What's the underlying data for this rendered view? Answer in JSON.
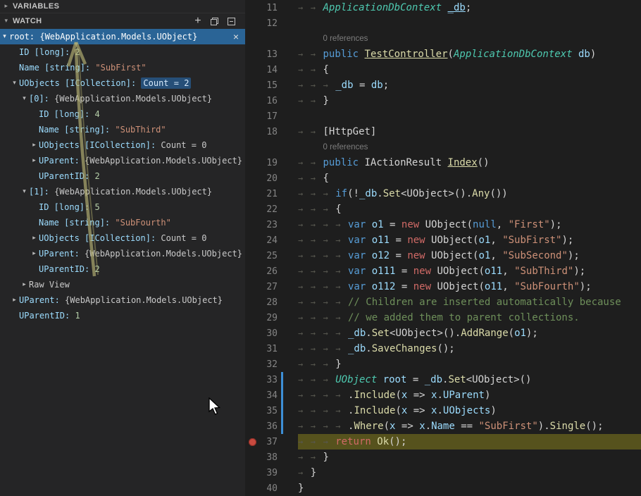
{
  "colors": {
    "selection_blue": "#2a6496",
    "current_line_highlight": "#56521d",
    "breakpoint_red": "#c84a3f",
    "modified_gutter_blue": "#3d8fd6",
    "sidebar_bg": "#252526",
    "editor_bg": "#1e1e1e"
  },
  "icons": {
    "add": "+",
    "close": "×",
    "twisty_down": "▾",
    "twisty_right": "▸",
    "variables_chevron": "▸",
    "watch_chevron": "▾",
    "tab": "→"
  },
  "sidebar": {
    "variables_header": "VARIABLES",
    "watch_header": "WATCH",
    "rows": [
      {
        "indent": 0,
        "twisty": "down",
        "selected": true,
        "close": true,
        "parts": [
          [
            "sel",
            "root: {WebApplication.Models.UObject}"
          ]
        ]
      },
      {
        "indent": 1,
        "parts": [
          [
            "name",
            "ID [long]: "
          ],
          [
            "num",
            "2"
          ]
        ]
      },
      {
        "indent": 1,
        "parts": [
          [
            "name",
            "Name [string]: "
          ],
          [
            "str",
            "\"SubFirst\""
          ]
        ]
      },
      {
        "indent": 1,
        "twisty": "down",
        "parts": [
          [
            "name",
            "UObjects [ICollection]: "
          ],
          [
            "chip",
            "Count = 2"
          ]
        ]
      },
      {
        "indent": 2,
        "twisty": "down",
        "parts": [
          [
            "name",
            "[0]: "
          ],
          [
            "obj",
            "{WebApplication.Models.UObject}"
          ]
        ]
      },
      {
        "indent": 3,
        "parts": [
          [
            "name",
            "ID [long]: "
          ],
          [
            "num",
            "4"
          ]
        ]
      },
      {
        "indent": 3,
        "parts": [
          [
            "name",
            "Name [string]: "
          ],
          [
            "str",
            "\"SubThird\""
          ]
        ]
      },
      {
        "indent": 3,
        "twisty": "right",
        "parts": [
          [
            "name",
            "UObjects [ICollection]: "
          ],
          [
            "obj",
            "Count = 0"
          ]
        ]
      },
      {
        "indent": 3,
        "twisty": "right",
        "parts": [
          [
            "name",
            "UParent: "
          ],
          [
            "obj",
            "{WebApplication.Models.UObject}"
          ]
        ]
      },
      {
        "indent": 3,
        "parts": [
          [
            "name",
            "UParentID: "
          ],
          [
            "num",
            "2"
          ]
        ]
      },
      {
        "indent": 2,
        "twisty": "down",
        "parts": [
          [
            "name",
            "[1]: "
          ],
          [
            "obj",
            "{WebApplication.Models.UObject}"
          ]
        ]
      },
      {
        "indent": 3,
        "parts": [
          [
            "name",
            "ID [long]: "
          ],
          [
            "num",
            "5"
          ]
        ]
      },
      {
        "indent": 3,
        "parts": [
          [
            "name",
            "Name [string]: "
          ],
          [
            "str",
            "\"SubFourth\""
          ]
        ]
      },
      {
        "indent": 3,
        "twisty": "right",
        "parts": [
          [
            "name",
            "UObjects [ICollection]: "
          ],
          [
            "obj",
            "Count = 0"
          ]
        ]
      },
      {
        "indent": 3,
        "twisty": "right",
        "parts": [
          [
            "name",
            "UParent: "
          ],
          [
            "obj",
            "{WebApplication.Models.UObject}"
          ]
        ]
      },
      {
        "indent": 3,
        "parts": [
          [
            "name",
            "UParentID: "
          ],
          [
            "num",
            "2"
          ]
        ]
      },
      {
        "indent": 2,
        "twisty": "right",
        "parts": [
          [
            "obj",
            "Raw View"
          ]
        ]
      },
      {
        "indent": 1,
        "twisty": "right",
        "parts": [
          [
            "name",
            "UParent: "
          ],
          [
            "obj",
            "{WebApplication.Models.UObject}"
          ]
        ]
      },
      {
        "indent": 1,
        "parts": [
          [
            "name",
            "UParentID: "
          ],
          [
            "num",
            "1"
          ]
        ]
      }
    ]
  },
  "editor": {
    "rows": [
      {
        "type": "code",
        "num": 11,
        "indent": 2,
        "tokens": [
          [
            "typei",
            "ApplicationDbContext"
          ],
          [
            "txt",
            " "
          ],
          [
            "varu",
            "_db"
          ],
          [
            "txt",
            ";"
          ]
        ]
      },
      {
        "type": "code",
        "num": 12,
        "indent": 0,
        "tokens": []
      },
      {
        "type": "lens",
        "text": "0 references"
      },
      {
        "type": "code",
        "num": 13,
        "indent": 2,
        "tokens": [
          [
            "kw",
            "public"
          ],
          [
            "txt",
            " "
          ],
          [
            "fnu",
            "TestController"
          ],
          [
            "txt",
            "("
          ],
          [
            "typei",
            "ApplicationDbContext"
          ],
          [
            "txt",
            " "
          ],
          [
            "var",
            "db"
          ],
          [
            "txt",
            ")"
          ]
        ]
      },
      {
        "type": "code",
        "num": 14,
        "indent": 2,
        "tokens": [
          [
            "txt",
            "{"
          ]
        ]
      },
      {
        "type": "code",
        "num": 15,
        "indent": 3,
        "tokens": [
          [
            "var",
            "_db"
          ],
          [
            "txt",
            " = "
          ],
          [
            "var",
            "db"
          ],
          [
            "txt",
            ";"
          ]
        ]
      },
      {
        "type": "code",
        "num": 16,
        "indent": 2,
        "tokens": [
          [
            "txt",
            "}"
          ]
        ]
      },
      {
        "type": "code",
        "num": 17,
        "indent": 0,
        "tokens": []
      },
      {
        "type": "code",
        "num": 18,
        "indent": 2,
        "tokens": [
          [
            "txt",
            "[HttpGet]"
          ]
        ]
      },
      {
        "type": "lens",
        "text": "0 references"
      },
      {
        "type": "code",
        "num": 19,
        "indent": 2,
        "tokens": [
          [
            "kw",
            "public"
          ],
          [
            "txt",
            " IActionResult "
          ],
          [
            "fnu",
            "Index"
          ],
          [
            "txt",
            "()"
          ]
        ]
      },
      {
        "type": "code",
        "num": 20,
        "indent": 2,
        "tokens": [
          [
            "txt",
            "{"
          ]
        ]
      },
      {
        "type": "code",
        "num": 21,
        "indent": 3,
        "tokens": [
          [
            "kw",
            "if"
          ],
          [
            "txt",
            "(!"
          ],
          [
            "var",
            "_db"
          ],
          [
            "txt",
            "."
          ],
          [
            "fn",
            "Set"
          ],
          [
            "txt",
            "<UObject>()."
          ],
          [
            "fn",
            "Any"
          ],
          [
            "txt",
            "())"
          ]
        ]
      },
      {
        "type": "code",
        "num": 22,
        "indent": 3,
        "tokens": [
          [
            "txt",
            "{"
          ]
        ]
      },
      {
        "type": "code",
        "num": 23,
        "indent": 4,
        "tokens": [
          [
            "kw",
            "var"
          ],
          [
            "txt",
            " "
          ],
          [
            "var",
            "o1"
          ],
          [
            "txt",
            " = "
          ],
          [
            "kw2",
            "new"
          ],
          [
            "txt",
            " UObject("
          ],
          [
            "kw",
            "null"
          ],
          [
            "txt",
            ", "
          ],
          [
            "str",
            "\"First\""
          ],
          [
            "txt",
            ");"
          ]
        ]
      },
      {
        "type": "code",
        "num": 24,
        "indent": 4,
        "tokens": [
          [
            "kw",
            "var"
          ],
          [
            "txt",
            " "
          ],
          [
            "var",
            "o11"
          ],
          [
            "txt",
            " = "
          ],
          [
            "kw2",
            "new"
          ],
          [
            "txt",
            " UObject("
          ],
          [
            "var",
            "o1"
          ],
          [
            "txt",
            ", "
          ],
          [
            "str",
            "\"SubFirst\""
          ],
          [
            "txt",
            ");"
          ]
        ]
      },
      {
        "type": "code",
        "num": 25,
        "indent": 4,
        "tokens": [
          [
            "kw",
            "var"
          ],
          [
            "txt",
            " "
          ],
          [
            "var",
            "o12"
          ],
          [
            "txt",
            " = "
          ],
          [
            "kw2",
            "new"
          ],
          [
            "txt",
            " UObject("
          ],
          [
            "var",
            "o1"
          ],
          [
            "txt",
            ", "
          ],
          [
            "str",
            "\"SubSecond\""
          ],
          [
            "txt",
            ");"
          ]
        ]
      },
      {
        "type": "code",
        "num": 26,
        "indent": 4,
        "tokens": [
          [
            "kw",
            "var"
          ],
          [
            "txt",
            " "
          ],
          [
            "var",
            "o111"
          ],
          [
            "txt",
            " = "
          ],
          [
            "kw2",
            "new"
          ],
          [
            "txt",
            " UObject("
          ],
          [
            "var",
            "o11"
          ],
          [
            "txt",
            ", "
          ],
          [
            "str",
            "\"SubThird\""
          ],
          [
            "txt",
            ");"
          ]
        ]
      },
      {
        "type": "code",
        "num": 27,
        "indent": 4,
        "tokens": [
          [
            "kw",
            "var"
          ],
          [
            "txt",
            " "
          ],
          [
            "var",
            "o112"
          ],
          [
            "txt",
            " = "
          ],
          [
            "kw2",
            "new"
          ],
          [
            "txt",
            " UObject("
          ],
          [
            "var",
            "o11"
          ],
          [
            "txt",
            ", "
          ],
          [
            "str",
            "\"SubFourth\""
          ],
          [
            "txt",
            ");"
          ]
        ]
      },
      {
        "type": "code",
        "num": 28,
        "indent": 4,
        "tokens": [
          [
            "com",
            "// Children are inserted automatically because"
          ]
        ]
      },
      {
        "type": "code",
        "num": 29,
        "indent": 4,
        "tokens": [
          [
            "com",
            "// we added them to parent collections."
          ]
        ]
      },
      {
        "type": "code",
        "num": 30,
        "indent": 4,
        "tokens": [
          [
            "var",
            "_db"
          ],
          [
            "txt",
            "."
          ],
          [
            "fn",
            "Set"
          ],
          [
            "txt",
            "<UObject>()."
          ],
          [
            "fn",
            "AddRange"
          ],
          [
            "txt",
            "("
          ],
          [
            "var",
            "o1"
          ],
          [
            "txt",
            ");"
          ]
        ]
      },
      {
        "type": "code",
        "num": 31,
        "indent": 4,
        "tokens": [
          [
            "var",
            "_db"
          ],
          [
            "txt",
            "."
          ],
          [
            "fn",
            "SaveChanges"
          ],
          [
            "txt",
            "();"
          ]
        ]
      },
      {
        "type": "code",
        "num": 32,
        "indent": 3,
        "tokens": [
          [
            "txt",
            "}"
          ]
        ]
      },
      {
        "type": "code",
        "num": 33,
        "indent": 3,
        "mod": true,
        "tokens": [
          [
            "typei",
            "UObject"
          ],
          [
            "txt",
            " "
          ],
          [
            "var",
            "root"
          ],
          [
            "txt",
            " = "
          ],
          [
            "var",
            "_db"
          ],
          [
            "txt",
            "."
          ],
          [
            "fn",
            "Set"
          ],
          [
            "txt",
            "<UObject>()"
          ]
        ]
      },
      {
        "type": "code",
        "num": 34,
        "indent": 4,
        "mod": true,
        "tokens": [
          [
            "txt",
            "."
          ],
          [
            "fn",
            "Include"
          ],
          [
            "txt",
            "("
          ],
          [
            "var",
            "x"
          ],
          [
            "txt",
            " => "
          ],
          [
            "var",
            "x"
          ],
          [
            "txt",
            "."
          ],
          [
            "var",
            "UParent"
          ],
          [
            "txt",
            ")"
          ]
        ]
      },
      {
        "type": "code",
        "num": 35,
        "indent": 4,
        "mod": true,
        "tokens": [
          [
            "txt",
            "."
          ],
          [
            "fn",
            "Include"
          ],
          [
            "txt",
            "("
          ],
          [
            "var",
            "x"
          ],
          [
            "txt",
            " => "
          ],
          [
            "var",
            "x"
          ],
          [
            "txt",
            "."
          ],
          [
            "var",
            "UObjects"
          ],
          [
            "txt",
            ")"
          ]
        ]
      },
      {
        "type": "code",
        "num": 36,
        "indent": 4,
        "mod": true,
        "tokens": [
          [
            "txt",
            "."
          ],
          [
            "fn",
            "Where"
          ],
          [
            "txt",
            "("
          ],
          [
            "var",
            "x"
          ],
          [
            "txt",
            " => "
          ],
          [
            "var",
            "x"
          ],
          [
            "txt",
            "."
          ],
          [
            "var",
            "Name"
          ],
          [
            "txt",
            " == "
          ],
          [
            "str",
            "\"SubFirst\""
          ],
          [
            "txt",
            ")."
          ],
          [
            "fn",
            "Single"
          ],
          [
            "txt",
            "();"
          ]
        ]
      },
      {
        "type": "code",
        "num": 37,
        "indent": 3,
        "bp": true,
        "current": true,
        "tokens": [
          [
            "kw2",
            "return"
          ],
          [
            "txt",
            " "
          ],
          [
            "fn",
            "Ok"
          ],
          [
            "txt",
            "();"
          ]
        ]
      },
      {
        "type": "code",
        "num": 38,
        "indent": 2,
        "tokens": [
          [
            "txt",
            "}"
          ]
        ]
      },
      {
        "type": "code",
        "num": 39,
        "indent": 1,
        "tokens": [
          [
            "txt",
            "}"
          ]
        ]
      },
      {
        "type": "code",
        "num": 40,
        "indent": 0,
        "tokens": [
          [
            "txt",
            "}"
          ]
        ]
      }
    ]
  }
}
